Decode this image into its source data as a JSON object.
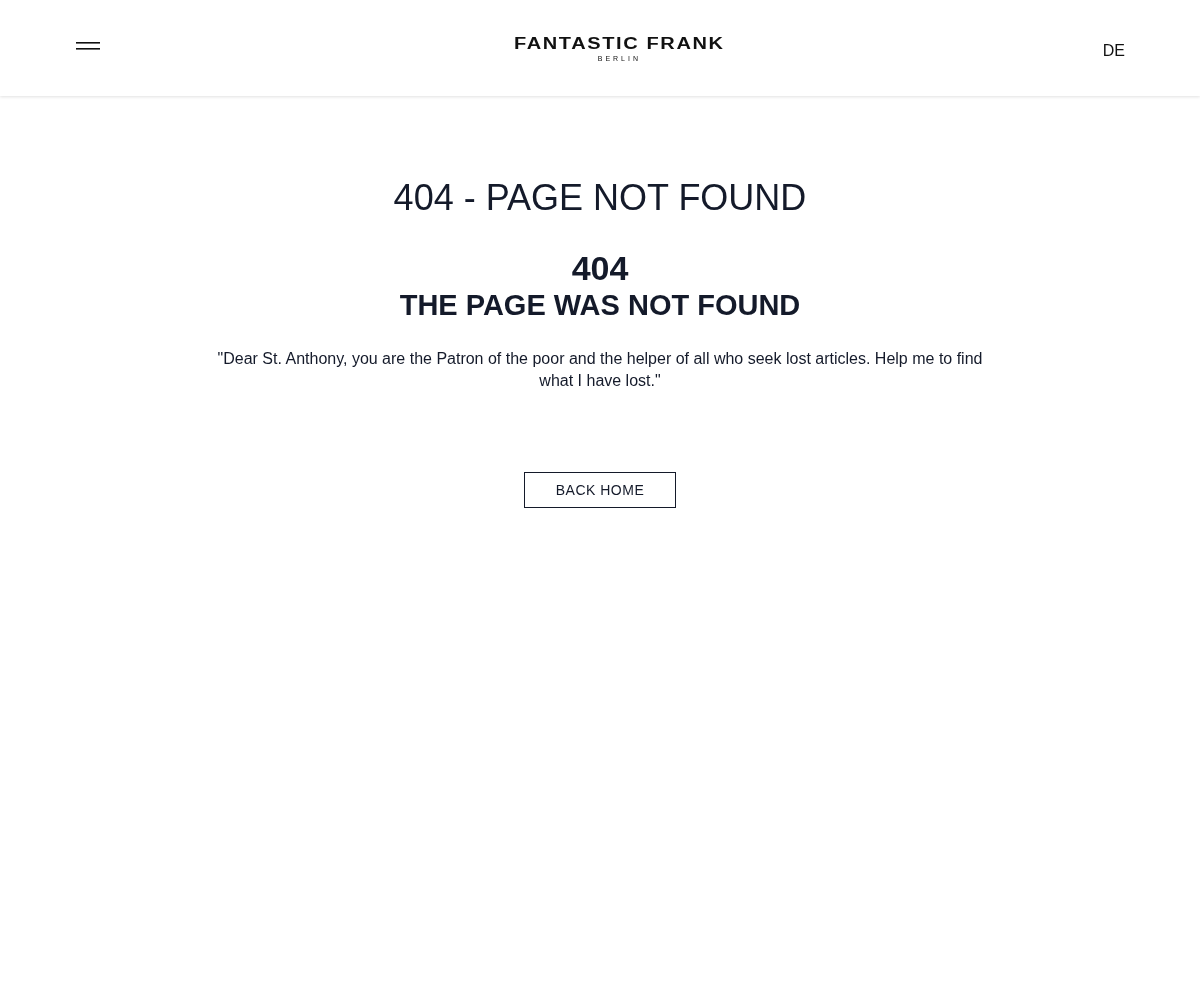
{
  "header": {
    "logo": {
      "name": "FANTASTIC FRANK",
      "city": "BERLIN"
    },
    "language": "DE"
  },
  "main": {
    "title": "404 - PAGE NOT FOUND",
    "code": "404",
    "subtitle": "THE PAGE WAS NOT FOUND",
    "quote": "\"Dear St. Anthony, you are the Patron of the poor and the helper of all who seek lost articles. Help me to find what I have lost.\"",
    "button": "BACK HOME"
  }
}
